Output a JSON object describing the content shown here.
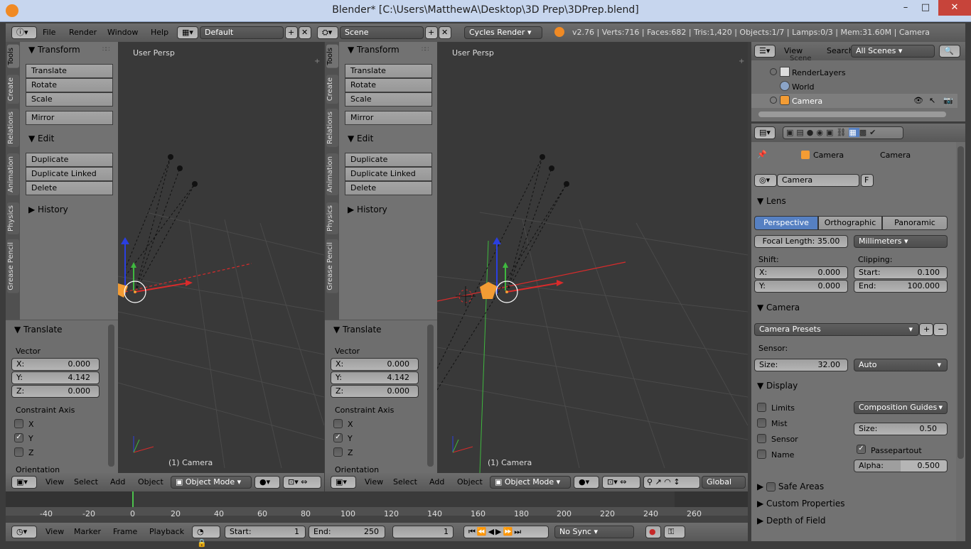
{
  "window": {
    "title": "Blender* [C:\\Users\\MatthewA\\Desktop\\3D Prep\\3DPrep.blend]",
    "min": "–",
    "max": "□",
    "close": "✕"
  },
  "topbar": {
    "menus": [
      "File",
      "Render",
      "Window",
      "Help"
    ],
    "layout": "Default",
    "scene": "Scene",
    "engine": "Cycles Render",
    "stats": "v2.76 | Verts:716 | Faces:682 | Tris:1,420 | Objects:1/7 | Lamps:0/3 | Mem:31.60M | Camera"
  },
  "tool_tabs": [
    "Tools",
    "Create",
    "Relations",
    "Animation",
    "Physics",
    "Grease Pencil"
  ],
  "toolshelf": {
    "transform_title": "Transform",
    "transform_buttons": [
      "Translate",
      "Rotate",
      "Scale"
    ],
    "mirror": "Mirror",
    "edit_title": "Edit",
    "edit_buttons": [
      "Duplicate",
      "Duplicate Linked",
      "Delete"
    ],
    "history_title": "History"
  },
  "operator": {
    "title": "Translate",
    "vector_label": "Vector",
    "x": "X:",
    "x_val": "0.000",
    "y": "Y:",
    "y_val": "4.142",
    "z": "Z:",
    "z_val": "0.000",
    "constraint_label": "Constraint Axis",
    "axes": [
      "X",
      "Y",
      "Z"
    ],
    "orientation": "Orientation"
  },
  "viewport": {
    "label": "User Persp",
    "object": "(1) Camera"
  },
  "view3d_header": {
    "menus": [
      "View",
      "Select",
      "Add",
      "Object"
    ],
    "mode": "Object Mode",
    "orientation": "Global"
  },
  "timeline": {
    "ticks": [
      "-40",
      "-20",
      "0",
      "20",
      "40",
      "60",
      "80",
      "100",
      "120",
      "140",
      "160",
      "180",
      "200",
      "220",
      "240",
      "260"
    ],
    "menus": [
      "View",
      "Marker",
      "Frame",
      "Playback"
    ],
    "start": "Start:",
    "start_val": "1",
    "end": "End:",
    "end_val": "250",
    "current": "1",
    "sync": "No Sync"
  },
  "outliner": {
    "menus": [
      "View",
      "Search"
    ],
    "filter": "All Scenes",
    "items": [
      "Scene",
      "RenderLayers",
      "World",
      "Camera"
    ]
  },
  "properties": {
    "breadcrumb": [
      "Camera",
      "Camera"
    ],
    "datablock": "Camera",
    "fake": "F",
    "lens_title": "Lens",
    "lens_types": [
      "Perspective",
      "Orthographic",
      "Panoramic"
    ],
    "focal": "Focal Length: 35.00",
    "lens_unit": "Millimeters",
    "shift_label": "Shift:",
    "clipping_label": "Clipping:",
    "shift_x": "X:",
    "shift_x_val": "0.000",
    "shift_y": "Y:",
    "shift_y_val": "0.000",
    "clip_start": "Start:",
    "clip_start_val": "0.100",
    "clip_end": "End:",
    "clip_end_val": "100.000",
    "camera_title": "Camera",
    "presets": "Camera Presets",
    "sensor_label": "Sensor:",
    "size": "Size:",
    "size_val": "32.00",
    "fit": "Auto",
    "display_title": "Display",
    "display_checks": [
      "Limits",
      "Mist",
      "Sensor",
      "Name"
    ],
    "guides": "Composition Guides",
    "dsize": "Size:",
    "dsize_val": "0.50",
    "passepartout": "Passepartout",
    "alpha": "Alpha:",
    "alpha_val": "0.500",
    "collapsed": [
      "Safe Areas",
      "Custom Properties",
      "Depth of Field"
    ]
  },
  "colors": {
    "accent": "#5680c2",
    "x_axis": "#d92b2b",
    "y_axis": "#3fb83f",
    "z_axis": "#2a3fe0",
    "selected": "#f39c34"
  }
}
